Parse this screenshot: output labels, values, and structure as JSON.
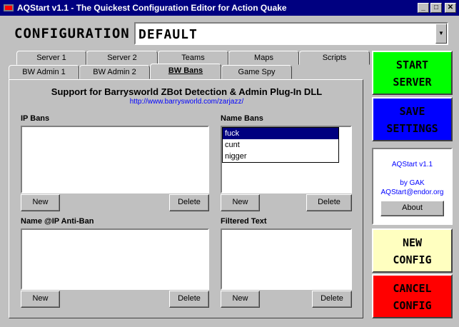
{
  "window": {
    "title": "AQStart v1.1 - The Quickest Configuration Editor for Action Quake",
    "minimize_glyph": "_",
    "maximize_glyph": "□",
    "close_glyph": "✕"
  },
  "config": {
    "label": "CONFIGURATION",
    "value": "DEFAULT",
    "dropdown_glyph": "▼"
  },
  "tabs": {
    "row1": [
      "Server 1",
      "Server 2",
      "Teams",
      "Maps",
      "Scripts"
    ],
    "row2": [
      "BW Admin 1",
      "BW Admin 2",
      "BW Bans",
      "Game Spy"
    ],
    "active": "BW Bans"
  },
  "panel": {
    "title": "Support for Barrysworld ZBot Detection & Admin Plug-In DLL",
    "link": "http://www.barrysworld.com/zarjazz/",
    "ip_bans": {
      "label": "IP Bans",
      "items": [],
      "new_label": "New",
      "delete_label": "Delete"
    },
    "name_bans": {
      "label": "Name Bans",
      "items": [
        "fuck",
        "cunt",
        "nigger"
      ],
      "selected_index": 0,
      "new_label": "New",
      "delete_label": "Delete"
    },
    "anti_ban": {
      "label": "Name @IP Anti-Ban",
      "items": [],
      "new_label": "New",
      "delete_label": "Delete"
    },
    "filtered_text": {
      "label": "Filtered Text",
      "items": [],
      "new_label": "New",
      "delete_label": "Delete"
    }
  },
  "side": {
    "start_server": {
      "line1": "START",
      "line2": "SERVER",
      "bg": "#00ff00",
      "fg": "#000000"
    },
    "save_settings": {
      "line1": "SAVE",
      "line2": "SETTINGS",
      "bg": "#0000ff",
      "fg": "#000000"
    },
    "info": {
      "version": "AQStart v1.1",
      "by": "by GAK",
      "email": "AQStart@endor.org",
      "about_label": "About"
    },
    "new_config": {
      "line1": "NEW",
      "line2": "CONFIG",
      "bg": "#ffffc0",
      "fg": "#000000"
    },
    "cancel_config": {
      "line1": "CANCEL",
      "line2": "CONFIG",
      "bg": "#ff0000",
      "fg": "#000000"
    }
  }
}
